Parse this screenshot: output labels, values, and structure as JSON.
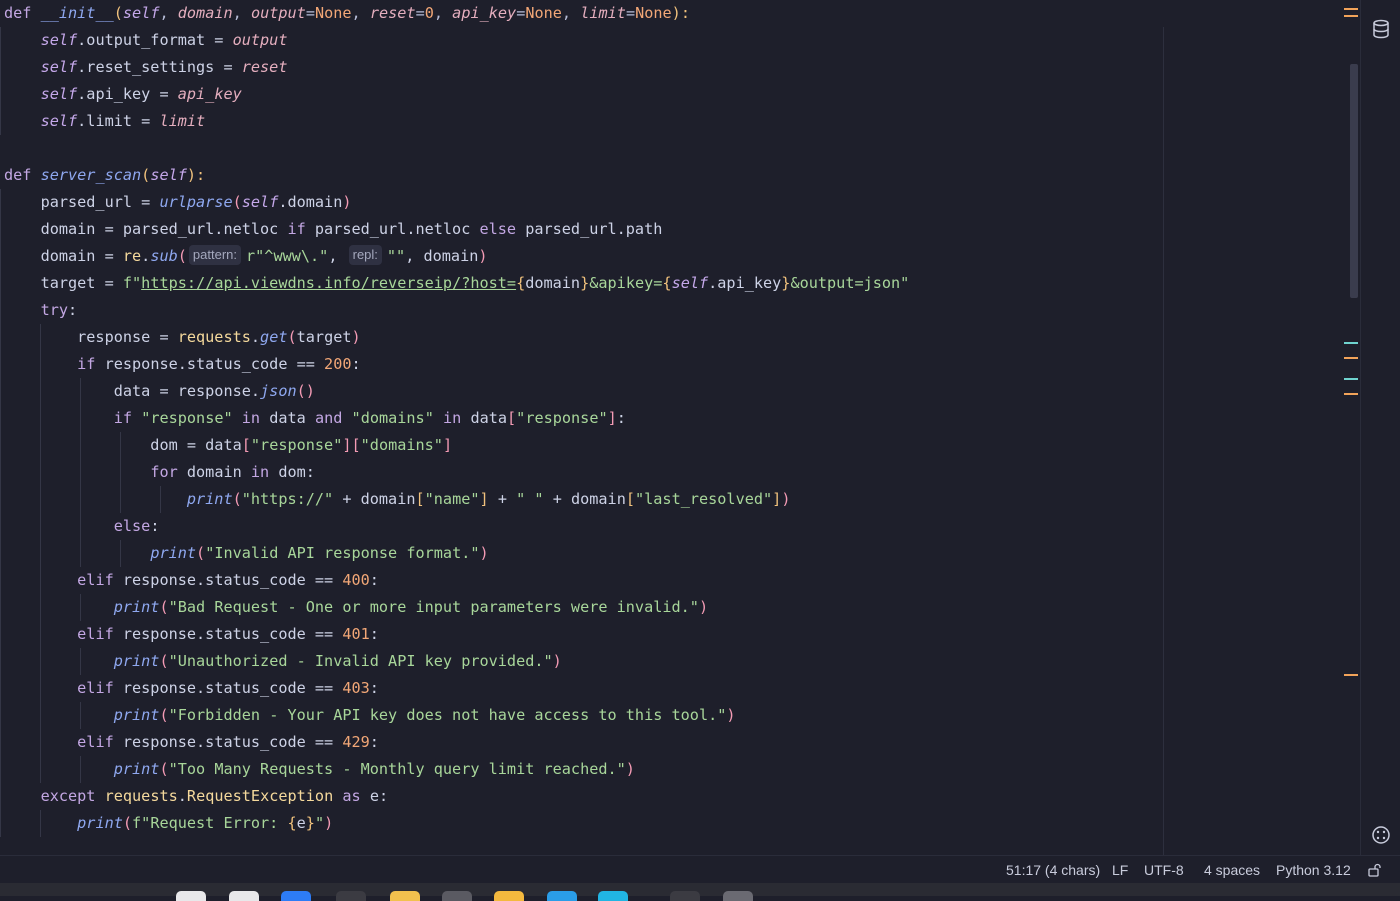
{
  "editor": {
    "lines": [
      [
        {
          "t": "def ",
          "c": "kw"
        },
        {
          "t": "__init__",
          "c": "fn"
        },
        {
          "t": "(",
          "c": "p3"
        },
        {
          "t": "self",
          "c": "self"
        },
        {
          "t": ", ",
          "c": "op"
        },
        {
          "t": "domain",
          "c": "param"
        },
        {
          "t": ", ",
          "c": "op"
        },
        {
          "t": "output",
          "c": "param"
        },
        {
          "t": "=",
          "c": "op"
        },
        {
          "t": "None",
          "c": "const"
        },
        {
          "t": ", ",
          "c": "op"
        },
        {
          "t": "reset",
          "c": "param"
        },
        {
          "t": "=",
          "c": "op"
        },
        {
          "t": "0",
          "c": "num"
        },
        {
          "t": ", ",
          "c": "op"
        },
        {
          "t": "api_key",
          "c": "param"
        },
        {
          "t": "=",
          "c": "op"
        },
        {
          "t": "None",
          "c": "const"
        },
        {
          "t": ", ",
          "c": "op"
        },
        {
          "t": "limit",
          "c": "param"
        },
        {
          "t": "=",
          "c": "op"
        },
        {
          "t": "None",
          "c": "const"
        },
        {
          "t": "):",
          "c": "p3"
        }
      ],
      [
        {
          "t": "    "
        },
        {
          "t": "self",
          "c": "self"
        },
        {
          "t": ".output_format = "
        },
        {
          "t": "output",
          "c": "param"
        }
      ],
      [
        {
          "t": "    "
        },
        {
          "t": "self",
          "c": "self"
        },
        {
          "t": ".reset_settings = "
        },
        {
          "t": "reset",
          "c": "param"
        }
      ],
      [
        {
          "t": "    "
        },
        {
          "t": "self",
          "c": "self"
        },
        {
          "t": ".api_key = "
        },
        {
          "t": "api_key",
          "c": "param"
        }
      ],
      [
        {
          "t": "    "
        },
        {
          "t": "self",
          "c": "self"
        },
        {
          "t": ".limit = "
        },
        {
          "t": "limit",
          "c": "param"
        }
      ],
      [],
      [
        {
          "t": "def ",
          "c": "kw"
        },
        {
          "t": "server_scan",
          "c": "fn"
        },
        {
          "t": "(",
          "c": "p3"
        },
        {
          "t": "self",
          "c": "self"
        },
        {
          "t": "):",
          "c": "p3"
        }
      ],
      [
        {
          "t": "    parsed_url = "
        },
        {
          "t": "urlparse",
          "c": "fn"
        },
        {
          "t": "(",
          "c": "p2"
        },
        {
          "t": "self",
          "c": "self"
        },
        {
          "t": ".domain"
        },
        {
          "t": ")",
          "c": "p2"
        }
      ],
      [
        {
          "t": "    domain = parsed_url.netloc "
        },
        {
          "t": "if",
          "c": "kw"
        },
        {
          "t": " parsed_url.netloc "
        },
        {
          "t": "else",
          "c": "kw"
        },
        {
          "t": " parsed_url.path"
        }
      ],
      [
        {
          "t": "    domain = "
        },
        {
          "t": "re",
          "c": "cls"
        },
        {
          "t": "."
        },
        {
          "t": "sub",
          "c": "fn"
        },
        {
          "t": "(",
          "c": "p2"
        },
        {
          "t": "pattern:",
          "c": "hint"
        },
        {
          "t": "r\"^www\\.\"",
          "c": "str"
        },
        {
          "t": ", "
        },
        {
          "t": "repl:",
          "c": "hint"
        },
        {
          "t": "\"\"",
          "c": "str"
        },
        {
          "t": ", domain"
        },
        {
          "t": ")",
          "c": "p2"
        }
      ],
      [
        {
          "t": "    target = "
        },
        {
          "t": "f\"",
          "c": "str"
        },
        {
          "t": "https://api.viewdns.info/reverseip/?host=",
          "c": "url"
        },
        {
          "t": "{",
          "c": "p3"
        },
        {
          "t": "domain"
        },
        {
          "t": "}",
          "c": "p3"
        },
        {
          "t": "&apikey=",
          "c": "str"
        },
        {
          "t": "{",
          "c": "p3"
        },
        {
          "t": "self",
          "c": "self"
        },
        {
          "t": ".api_key"
        },
        {
          "t": "}",
          "c": "p3"
        },
        {
          "t": "&output=json\"",
          "c": "str"
        }
      ],
      [
        {
          "t": "    "
        },
        {
          "t": "try",
          "c": "kw"
        },
        {
          "t": ":"
        }
      ],
      [
        {
          "t": "        response = "
        },
        {
          "t": "requests",
          "c": "cls"
        },
        {
          "t": "."
        },
        {
          "t": "get",
          "c": "fn"
        },
        {
          "t": "(",
          "c": "p2"
        },
        {
          "t": "target"
        },
        {
          "t": ")",
          "c": "p2"
        }
      ],
      [
        {
          "t": "        "
        },
        {
          "t": "if",
          "c": "kw"
        },
        {
          "t": " response.status_code == "
        },
        {
          "t": "200",
          "c": "num"
        },
        {
          "t": ":"
        }
      ],
      [
        {
          "t": "            data = response."
        },
        {
          "t": "json",
          "c": "fn"
        },
        {
          "t": "()",
          "c": "p2"
        }
      ],
      [
        {
          "t": "            "
        },
        {
          "t": "if",
          "c": "kw"
        },
        {
          "t": " "
        },
        {
          "t": "\"response\"",
          "c": "str"
        },
        {
          "t": " "
        },
        {
          "t": "in",
          "c": "kw"
        },
        {
          "t": " data "
        },
        {
          "t": "and",
          "c": "kw"
        },
        {
          "t": " "
        },
        {
          "t": "\"domains\"",
          "c": "str"
        },
        {
          "t": " "
        },
        {
          "t": "in",
          "c": "kw"
        },
        {
          "t": " data"
        },
        {
          "t": "[",
          "c": "p2"
        },
        {
          "t": "\"response\"",
          "c": "str"
        },
        {
          "t": "]",
          "c": "p2"
        },
        {
          "t": ":"
        }
      ],
      [
        {
          "t": "                dom = data"
        },
        {
          "t": "[",
          "c": "p2"
        },
        {
          "t": "\"response\"",
          "c": "str"
        },
        {
          "t": "]",
          "c": "p2"
        },
        {
          "t": "[",
          "c": "p2"
        },
        {
          "t": "\"domains\"",
          "c": "str"
        },
        {
          "t": "]",
          "c": "p2"
        }
      ],
      [
        {
          "t": "                "
        },
        {
          "t": "for",
          "c": "kw"
        },
        {
          "t": " domain "
        },
        {
          "t": "in",
          "c": "kw"
        },
        {
          "t": " dom:"
        }
      ],
      [
        {
          "t": "                    "
        },
        {
          "t": "print",
          "c": "fn"
        },
        {
          "t": "(",
          "c": "p2"
        },
        {
          "t": "\"https://\"",
          "c": "str"
        },
        {
          "t": " + domain"
        },
        {
          "t": "[",
          "c": "p3"
        },
        {
          "t": "\"name\"",
          "c": "str"
        },
        {
          "t": "]",
          "c": "p3"
        },
        {
          "t": " + "
        },
        {
          "t": "\" \"",
          "c": "str"
        },
        {
          "t": " + domain"
        },
        {
          "t": "[",
          "c": "p3"
        },
        {
          "t": "\"last_resolved\"",
          "c": "str"
        },
        {
          "t": "]",
          "c": "p3"
        },
        {
          "t": ")",
          "c": "p2"
        }
      ],
      [
        {
          "t": "            "
        },
        {
          "t": "else",
          "c": "kw"
        },
        {
          "t": ":"
        }
      ],
      [
        {
          "t": "                "
        },
        {
          "t": "print",
          "c": "fn"
        },
        {
          "t": "(",
          "c": "p2"
        },
        {
          "t": "\"Invalid API response format.\"",
          "c": "str"
        },
        {
          "t": ")",
          "c": "p2"
        }
      ],
      [
        {
          "t": "        "
        },
        {
          "t": "elif",
          "c": "kw"
        },
        {
          "t": " response.status_code == "
        },
        {
          "t": "400",
          "c": "num"
        },
        {
          "t": ":"
        }
      ],
      [
        {
          "t": "            "
        },
        {
          "t": "print",
          "c": "fn"
        },
        {
          "t": "(",
          "c": "p2"
        },
        {
          "t": "\"Bad Request - One or more input parameters were invalid.\"",
          "c": "str"
        },
        {
          "t": ")",
          "c": "p2"
        }
      ],
      [
        {
          "t": "        "
        },
        {
          "t": "elif",
          "c": "kw"
        },
        {
          "t": " response.status_code == "
        },
        {
          "t": "401",
          "c": "num"
        },
        {
          "t": ":"
        }
      ],
      [
        {
          "t": "            "
        },
        {
          "t": "print",
          "c": "fn"
        },
        {
          "t": "(",
          "c": "p2"
        },
        {
          "t": "\"Unauthorized - Invalid API key provided.\"",
          "c": "str"
        },
        {
          "t": ")",
          "c": "p2"
        }
      ],
      [
        {
          "t": "        "
        },
        {
          "t": "elif",
          "c": "kw"
        },
        {
          "t": " response.status_code == "
        },
        {
          "t": "403",
          "c": "num"
        },
        {
          "t": ":"
        }
      ],
      [
        {
          "t": "            "
        },
        {
          "t": "print",
          "c": "fn"
        },
        {
          "t": "(",
          "c": "p2"
        },
        {
          "t": "\"Forbidden - Your API key does not have access to this tool.\"",
          "c": "str"
        },
        {
          "t": ")",
          "c": "p2"
        }
      ],
      [
        {
          "t": "        "
        },
        {
          "t": "elif",
          "c": "kw"
        },
        {
          "t": " response.status_code == "
        },
        {
          "t": "429",
          "c": "num"
        },
        {
          "t": ":"
        }
      ],
      [
        {
          "t": "            "
        },
        {
          "t": "print",
          "c": "fn"
        },
        {
          "t": "(",
          "c": "p2"
        },
        {
          "t": "\"Too Many Requests - Monthly query limit reached.\"",
          "c": "str"
        },
        {
          "t": ")",
          "c": "p2"
        }
      ],
      [
        {
          "t": "    "
        },
        {
          "t": "except",
          "c": "kw"
        },
        {
          "t": " "
        },
        {
          "t": "requests",
          "c": "cls"
        },
        {
          "t": "."
        },
        {
          "t": "RequestException",
          "c": "cls"
        },
        {
          "t": " "
        },
        {
          "t": "as",
          "c": "kw"
        },
        {
          "t": " e:"
        }
      ],
      [
        {
          "t": "        "
        },
        {
          "t": "print",
          "c": "fn"
        },
        {
          "t": "(",
          "c": "p2"
        },
        {
          "t": "f\"Request Error: ",
          "c": "str"
        },
        {
          "t": "{",
          "c": "p3"
        },
        {
          "t": "e"
        },
        {
          "t": "}",
          "c": "p3"
        },
        {
          "t": "\"",
          "c": "str"
        },
        {
          "t": ")",
          "c": "p2"
        }
      ]
    ]
  },
  "status": {
    "position": "51:17 (4 chars)",
    "line_ending": "LF",
    "encoding": "UTF-8",
    "indent": "4 spaces",
    "interpreter": "Python 3.12"
  },
  "icons": {
    "top_right": "hamburger-icon",
    "strip_top": "database-icon",
    "strip_bottom": "plugin-icon",
    "status_lock": "unlock-icon"
  },
  "colors": {
    "background": "#1e1f2b",
    "keyword": "#c3a7e3",
    "string": "#a8d69a",
    "number": "#f2a777"
  }
}
